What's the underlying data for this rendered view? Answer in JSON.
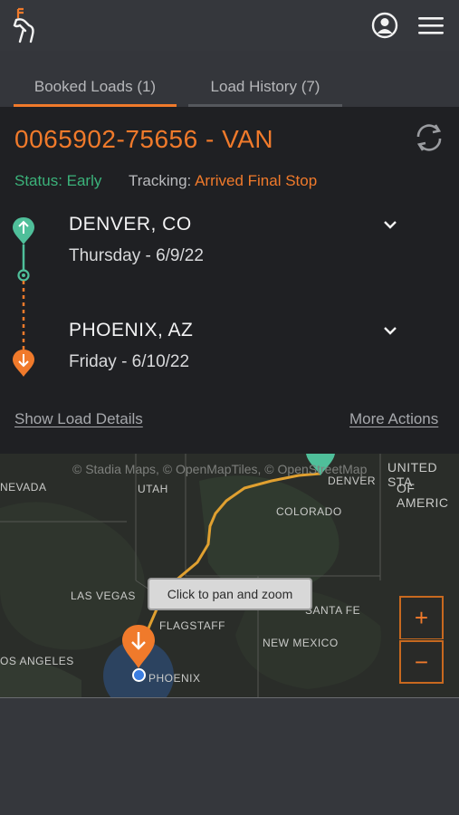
{
  "header": {
    "logo_icon": "deer-logo-icon",
    "user_icon": "user-circle-icon",
    "menu_icon": "hamburger-menu-icon"
  },
  "tabs": [
    {
      "label": "Booked Loads (1)",
      "active": true
    },
    {
      "label": "Load History (7)",
      "active": false
    }
  ],
  "load": {
    "title": "0065902-75656 - VAN",
    "status_label": "Status: Early",
    "tracking_label": "Tracking:",
    "tracking_value": "Arrived Final Stop",
    "stops": [
      {
        "city": "DENVER, CO",
        "date": "Thursday - 6/9/22",
        "type": "pickup"
      },
      {
        "city": "PHOENIX, AZ",
        "date": "Friday - 6/10/22",
        "type": "delivery"
      }
    ],
    "show_details_link": "Show Load Details",
    "more_actions_link": "More Actions"
  },
  "map": {
    "attribution": "© Stadia Maps, © OpenMapTiles, © OpenStreetMap",
    "tooltip": "Click to pan and zoom",
    "zoom_in": "+",
    "zoom_out": "−",
    "labels": {
      "nevada": "NEVADA",
      "utah": "UTAH",
      "denver": "DENVER",
      "colorado": "COLORADO",
      "united_states": "UNITED STA",
      "of_america": "OF AMERIC",
      "las_vegas": "LAS VEGAS",
      "flagstaff": "FLAGSTAFF",
      "santa_fe": "SANTA FE",
      "new_mexico": "NEW MEXICO",
      "los_angeles": "OS ANGELES",
      "phoenix": "PHOENIX"
    }
  },
  "colors": {
    "accent": "#f07a2b",
    "status_green": "#3bb27a",
    "pickup_teal": "#4fbf9a",
    "background": "#34363b",
    "card": "#1f2023"
  }
}
